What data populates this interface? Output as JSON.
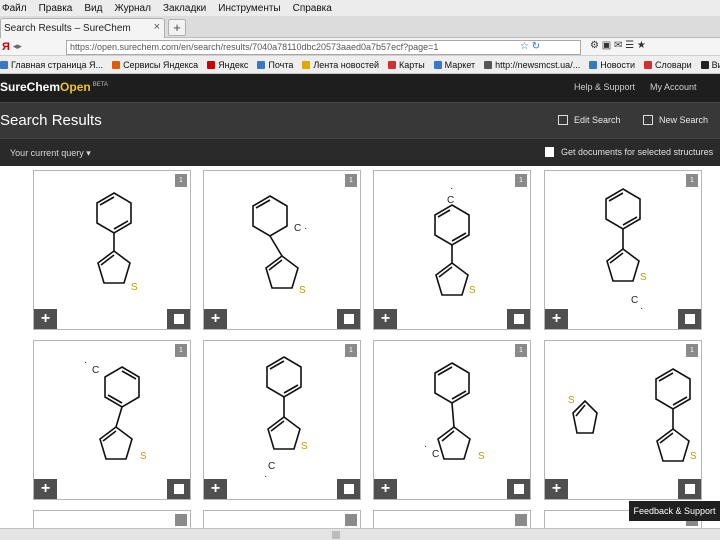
{
  "menu": [
    "Файл",
    "Правка",
    "Вид",
    "Журнал",
    "Закладки",
    "Инструменты",
    "Справка"
  ],
  "tab": {
    "title": "Search Results – SureChem"
  },
  "address": {
    "url": "https://open.surechem.com/en/search/results/7040a78110dbc20573aaed0a7b57ecf?page=1"
  },
  "bookmarks": [
    "Главная страница Я...",
    "Сервисы Яндекса",
    "Яндекс",
    "Почта",
    "Лента новостей",
    "Карты",
    "Маркет",
    "http://newsmcst.ua/...",
    "Новости",
    "Словари",
    "Видео"
  ],
  "header": {
    "logo_main": "SureChem",
    "logo_open": "Open",
    "beta": "BETA",
    "help": "Help & Support",
    "account": "My Account"
  },
  "titlebar": {
    "title": "Search Results",
    "edit": "Edit Search",
    "new": "New Search"
  },
  "querybar": {
    "query": "Your current query",
    "download": "Get documents for selected structures"
  },
  "cards": [
    {
      "num": "1"
    },
    {
      "num": "1"
    },
    {
      "num": "1"
    },
    {
      "num": "1"
    },
    {
      "num": "1"
    },
    {
      "num": "1"
    },
    {
      "num": "1"
    },
    {
      "num": "1"
    }
  ],
  "feedback": "Feedback & Support",
  "colors": {
    "header_bg": "#1e1e1e",
    "titlebar_bg": "#383838",
    "accent": "#f0c020",
    "sulfur": "#b8a000"
  }
}
